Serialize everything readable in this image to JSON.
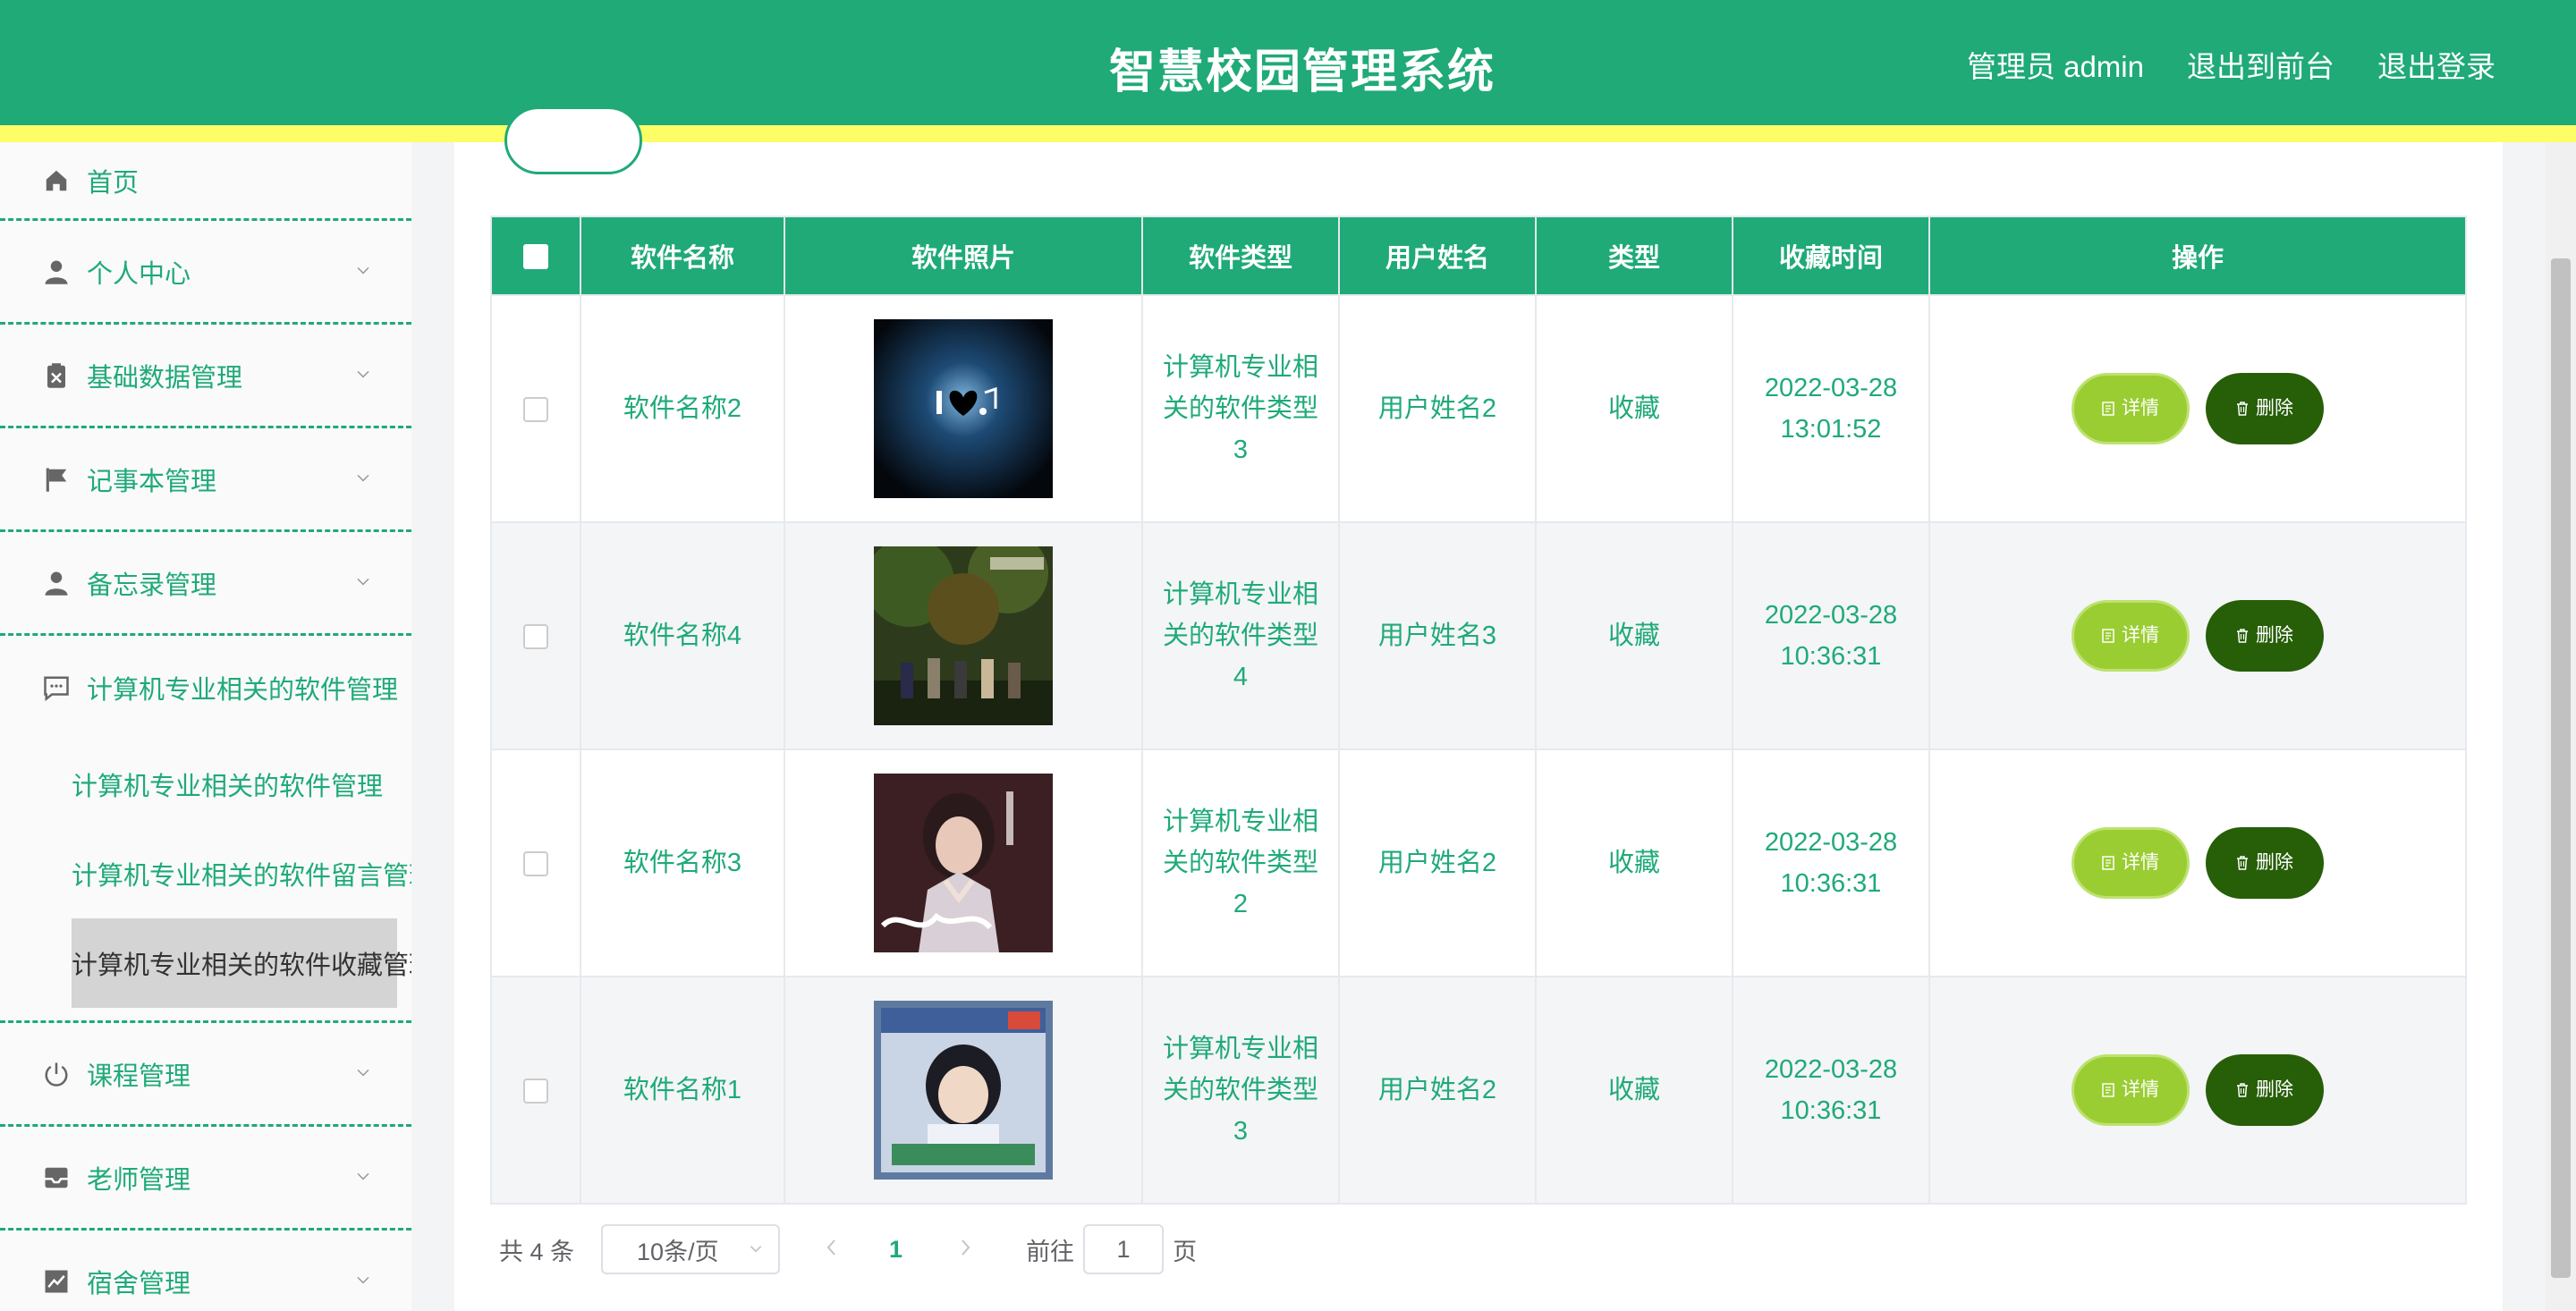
{
  "header": {
    "title": "智慧校园管理系统",
    "user": "管理员 admin",
    "to_front": "退出到前台",
    "logout": "退出登录"
  },
  "sidebar": {
    "home": "首页",
    "personal": "个人中心",
    "basic_data": "基础数据管理",
    "notebook": "记事本管理",
    "memo": "备忘录管理",
    "software": "计算机专业相关的软件管理",
    "software_subs": [
      "计算机专业相关的软件管理",
      "计算机专业相关的软件留言管理",
      "计算机专业相关的软件收藏管理"
    ],
    "course": "课程管理",
    "teacher": "老师管理",
    "dorm": "宿舍管理"
  },
  "colors": {
    "primary": "#1faa78",
    "stripe": "#fdfd66",
    "detail": "#9acd32",
    "delete": "#275e08"
  },
  "table": {
    "headers": [
      "软件名称",
      "软件照片",
      "软件类型",
      "用户姓名",
      "类型",
      "收藏时间",
      "操作"
    ],
    "detail_label": "详情",
    "delete_label": "删除",
    "rows": [
      {
        "name": "软件名称2",
        "type_line1": "计算机专业相",
        "type_line2": "关的软件类型",
        "type_line3": "3",
        "user": "用户姓名2",
        "kind": "收藏",
        "date": "2022-03-28",
        "time": "13:01:52",
        "image": "music-heart-cover"
      },
      {
        "name": "软件名称4",
        "type_line1": "计算机专业相",
        "type_line2": "关的软件类型",
        "type_line3": "4",
        "user": "用户姓名3",
        "kind": "收藏",
        "date": "2022-03-28",
        "time": "10:36:31",
        "image": "band-photo-cover"
      },
      {
        "name": "软件名称3",
        "type_line1": "计算机专业相",
        "type_line2": "关的软件类型",
        "type_line3": "2",
        "user": "用户姓名2",
        "kind": "收藏",
        "date": "2022-03-28",
        "time": "10:36:31",
        "image": "portrait-cover"
      },
      {
        "name": "软件名称1",
        "type_line1": "计算机专业相",
        "type_line2": "关的软件类型",
        "type_line3": "3",
        "user": "用户姓名2",
        "kind": "收藏",
        "date": "2022-03-28",
        "time": "10:36:31",
        "image": "album-cover"
      }
    ]
  },
  "pagination": {
    "total": "共 4 条",
    "page_size": "10条/页",
    "current": "1",
    "goto": "前往",
    "goto_value": "1",
    "page_unit": "页"
  }
}
